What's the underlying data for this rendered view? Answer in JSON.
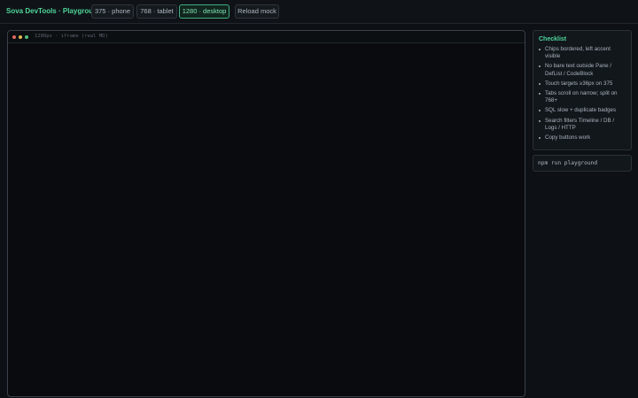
{
  "header": {
    "title": "Sova DevTools · Playground",
    "viewports": [
      {
        "label": "375 · phone",
        "active": false
      },
      {
        "label": "768 · tablet",
        "active": false
      },
      {
        "label": "1280 · desktop",
        "active": true
      }
    ],
    "reload_label": "Reload mock"
  },
  "preview": {
    "label": "1280px · iframe (real MD)",
    "window_dots": [
      "red",
      "yellow",
      "green"
    ]
  },
  "checklist": {
    "title": "Checklist",
    "items": [
      "Chips bordered, left accent visible",
      "No bare text outside Pane / DefList / CodeBlock",
      "Touch targets ≥36px on 375",
      "Tabs scroll on narrow; split on 768+",
      "SQL slow + duplicate badges",
      "Search filters Timeline / DB / Logs / HTTP",
      "Copy buttons work"
    ]
  },
  "command": "npm run playground",
  "colors": {
    "accent": "#4fd69a",
    "background": "#0d1014",
    "active_border": "#3fae7f"
  }
}
